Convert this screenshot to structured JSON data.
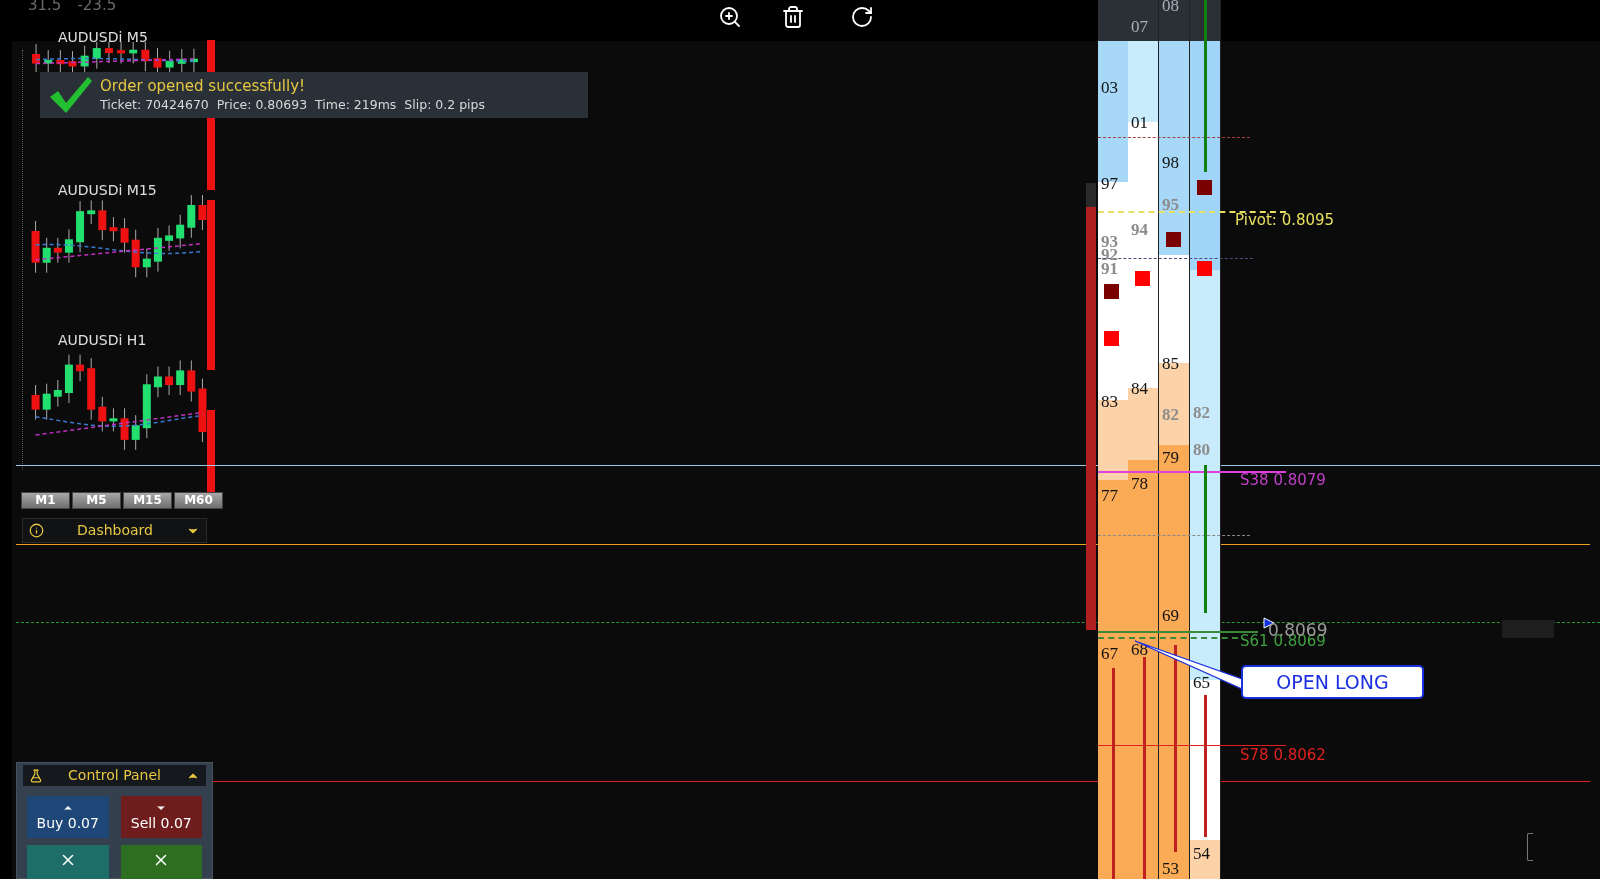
{
  "header_values": [
    "31.5",
    "-23.5"
  ],
  "mini_charts": [
    {
      "label": "AUDUSDi M5"
    },
    {
      "label": "AUDUSDi M15"
    },
    {
      "label": "AUDUSDi H1"
    }
  ],
  "notification": {
    "title": "Order opened successfully!",
    "details": "Ticket: 70424670  Price: 0.80693  Time: 219ms  Slip: 0.2 pips"
  },
  "timeframes": [
    "M1",
    "M5",
    "M15",
    "M60"
  ],
  "dashboard": {
    "label": "Dashboard"
  },
  "control_panel": {
    "title": "Control Panel",
    "buttons": [
      {
        "kind": "buy",
        "label": "Buy 0.07"
      },
      {
        "kind": "sell",
        "label": "Sell 0.07"
      },
      {
        "kind": "partial"
      },
      {
        "kind": "close_all"
      }
    ]
  },
  "ladder": {
    "columns": [
      {
        "labels": [
          {
            "text": "03",
            "kind": "level"
          },
          {
            "text": "97",
            "kind": "level"
          },
          {
            "text": "93",
            "kind": "faint"
          },
          {
            "text": "92",
            "kind": "faint"
          },
          {
            "text": "91",
            "kind": "faint"
          },
          {
            "text": "83",
            "kind": "level"
          },
          {
            "text": "77",
            "kind": "level"
          },
          {
            "text": "67",
            "kind": "level"
          }
        ]
      },
      {
        "labels": [
          {
            "text": "07",
            "kind": "level"
          },
          {
            "text": "01",
            "kind": "level"
          },
          {
            "text": "94",
            "kind": "faint"
          },
          {
            "text": "84",
            "kind": "level"
          },
          {
            "text": "78",
            "kind": "level"
          },
          {
            "text": "68",
            "kind": "level"
          }
        ]
      },
      {
        "labels": [
          {
            "text": "08",
            "kind": "level"
          },
          {
            "text": "98",
            "kind": "level"
          },
          {
            "text": "95",
            "kind": "faint"
          },
          {
            "text": "85",
            "kind": "level"
          },
          {
            "text": "82",
            "kind": "faint"
          },
          {
            "text": "79",
            "kind": "level"
          },
          {
            "text": "69",
            "kind": "level"
          },
          {
            "text": "53",
            "kind": "level"
          }
        ]
      },
      {
        "labels": [
          {
            "text": "82",
            "kind": "faint"
          },
          {
            "text": "80",
            "kind": "faint"
          },
          {
            "text": "65",
            "kind": "level"
          },
          {
            "text": "54",
            "kind": "level"
          }
        ]
      }
    ]
  },
  "price_lines": [
    {
      "label": "Pivot: 0.8095",
      "color": "#e8e060"
    },
    {
      "label": "S38 0.8079",
      "color": "#c040c8"
    },
    {
      "label": "S61 0.8069",
      "color": "#40a040"
    },
    {
      "label": "S78 0.8062",
      "color": "#e02020"
    }
  ],
  "current_price": "0.8069",
  "signal": {
    "label": "OPEN LONG"
  }
}
